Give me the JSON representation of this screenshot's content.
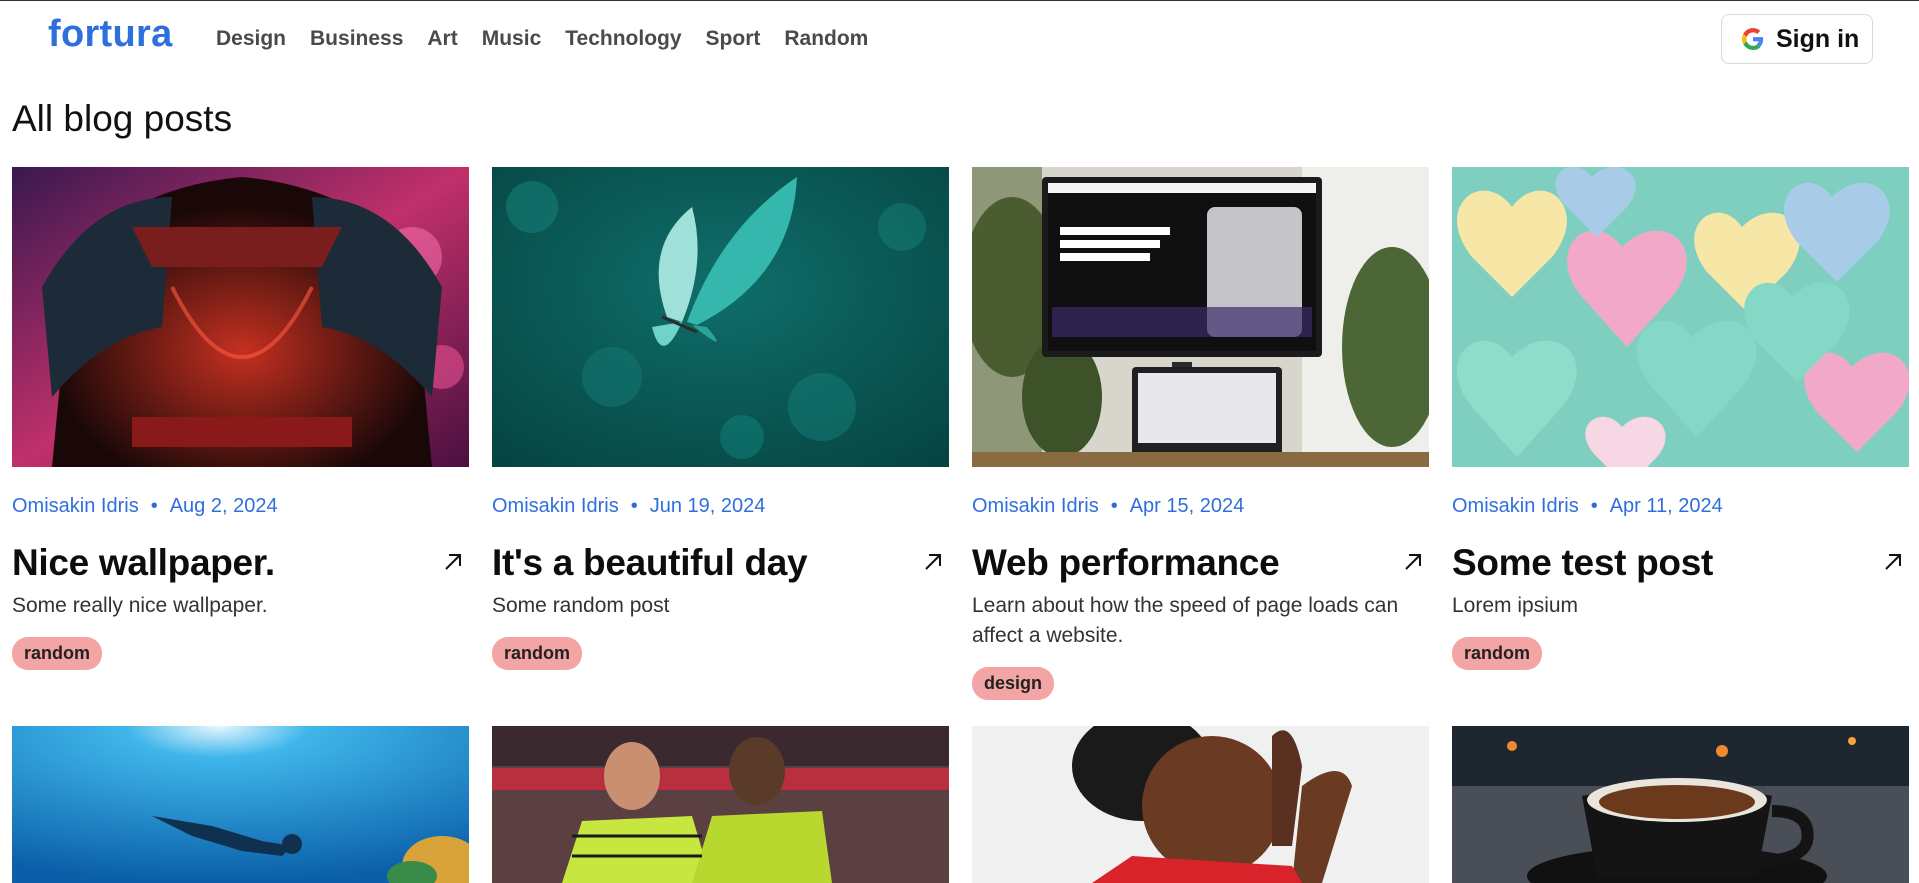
{
  "brand": {
    "name": "fortura",
    "accent": "#2f6fdc"
  },
  "nav": {
    "items": [
      "Design",
      "Business",
      "Art",
      "Music",
      "Technology",
      "Sport",
      "Random"
    ],
    "sign_in": "Sign in"
  },
  "page": {
    "title": "All blog posts"
  },
  "posts": [
    {
      "author": "Omisakin Idris",
      "date": "Aug 2, 2024",
      "title": "Nice wallpaper.",
      "description": "Some really nice wallpaper.",
      "tag": "random",
      "image": "armored-figure-neon"
    },
    {
      "author": "Omisakin Idris",
      "date": "Jun 19, 2024",
      "title": "It's a beautiful day",
      "description": "Some random post",
      "tag": "random",
      "image": "teal-butterfly"
    },
    {
      "author": "Omisakin Idris",
      "date": "Apr 15, 2024",
      "title": "Web performance",
      "description": "Learn about how the speed of page loads can affect a website.",
      "tag": "design",
      "image": "monitor-with-plants"
    },
    {
      "author": "Omisakin Idris",
      "date": "Apr 11, 2024",
      "title": "Some test post",
      "description": "Lorem ipsium",
      "tag": "random",
      "image": "pastel-hearts"
    }
  ],
  "more_posts_images": [
    "underwater-diver",
    "football-celebration",
    "illustrated-player",
    "coffee-cup"
  ],
  "colors": {
    "tag_bg": "#f3a4a4",
    "meta_text": "#2f6fdc"
  }
}
